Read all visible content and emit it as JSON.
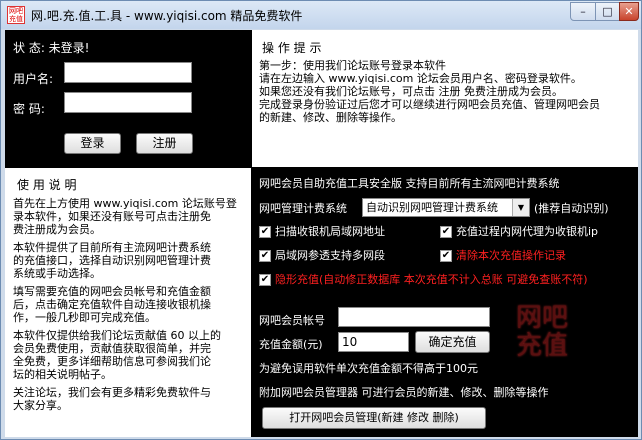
{
  "window": {
    "icon_text": "网吧充值",
    "title": "网.吧.充.值.工.具 - www.yiqisi.com 精品免费软件",
    "minimize_glyph": "–",
    "maximize_glyph": "□",
    "close_glyph": "✕"
  },
  "login": {
    "status_label": "状 态: 未登录!",
    "username_label": "用户名:",
    "username_value": "",
    "password_label": "密  码:",
    "password_value": "",
    "login_button": "登录",
    "register_button": "注册"
  },
  "tips": {
    "heading": "操 作 提 示",
    "lines": [
      "第一步：使用我们论坛账号登录本软件",
      "请在左边输入 www.yiqisi.com 论坛会员用户名、密码登录软件。",
      "如果您还没有我们论坛账号，可点击 注册 免费注册成为会员。",
      "完成登录身份验证过后您才可以继续进行网吧会员充值、管理网吧会员",
      "的新建、修改、删除等操作。"
    ]
  },
  "usage": {
    "heading": "使 用 说 明",
    "paragraphs": [
      "首先在上方使用 www.yiqisi.com 论坛账号登\n录本软件，如果还没有账号可点击注册免\n费注册成为会员。",
      "本软件提供了目前所有主流网吧计费系统\n的充值接口，选择自动识别网吧管理计费\n系统或手动选择。",
      "填写需要充值的网吧会员帐号和充值金额\n后，点击确定充值软件自动连接收银机操\n作，一般几秒即可完成充值。",
      "本软件仅提供给我们论坛贡献值 60 以上的\n会员免费使用，贡献值获取很简单，并完\n全免费，更多详细帮助信息可参阅我们论\n坛的相关说明帖子。",
      "关注论坛，我们会有更多精彩免费软件与\n大家分享。"
    ]
  },
  "tool": {
    "header": "网吧会员自助充值工具安全版 支持目前所有主流网吧计费系统",
    "system_label": "网吧管理计费系统",
    "system_selected": "自动识别网吧管理计费系统",
    "system_hint": "(推荐自动识别)",
    "options": [
      {
        "label": "扫描收银机局域网地址",
        "checked": true,
        "red": false
      },
      {
        "label": "充值过程内网代理为收银机ip",
        "checked": true,
        "red": false
      },
      {
        "label": "局域网参透支持多网段",
        "checked": true,
        "red": false
      },
      {
        "label": "清除本次充值操作记录",
        "checked": true,
        "red": true
      },
      {
        "label": "隐形充值(自动修正数据库 本次充值不计入总账 可避免查账不符)",
        "checked": true,
        "red": true
      }
    ],
    "account_label": "网吧会员帐号",
    "account_value": "",
    "amount_label": "充值金额(元)",
    "amount_value": "10",
    "confirm_button": "确定充值",
    "logo_text": "网吧\n充值",
    "warning": "为避免误用软件单次充值金额不得高于100元",
    "manager_text": "附加网吧会员管理器 可进行会员的新建、修改、删除等操作",
    "manager_button": "打开网吧会员管理(新建 修改 删除)"
  }
}
